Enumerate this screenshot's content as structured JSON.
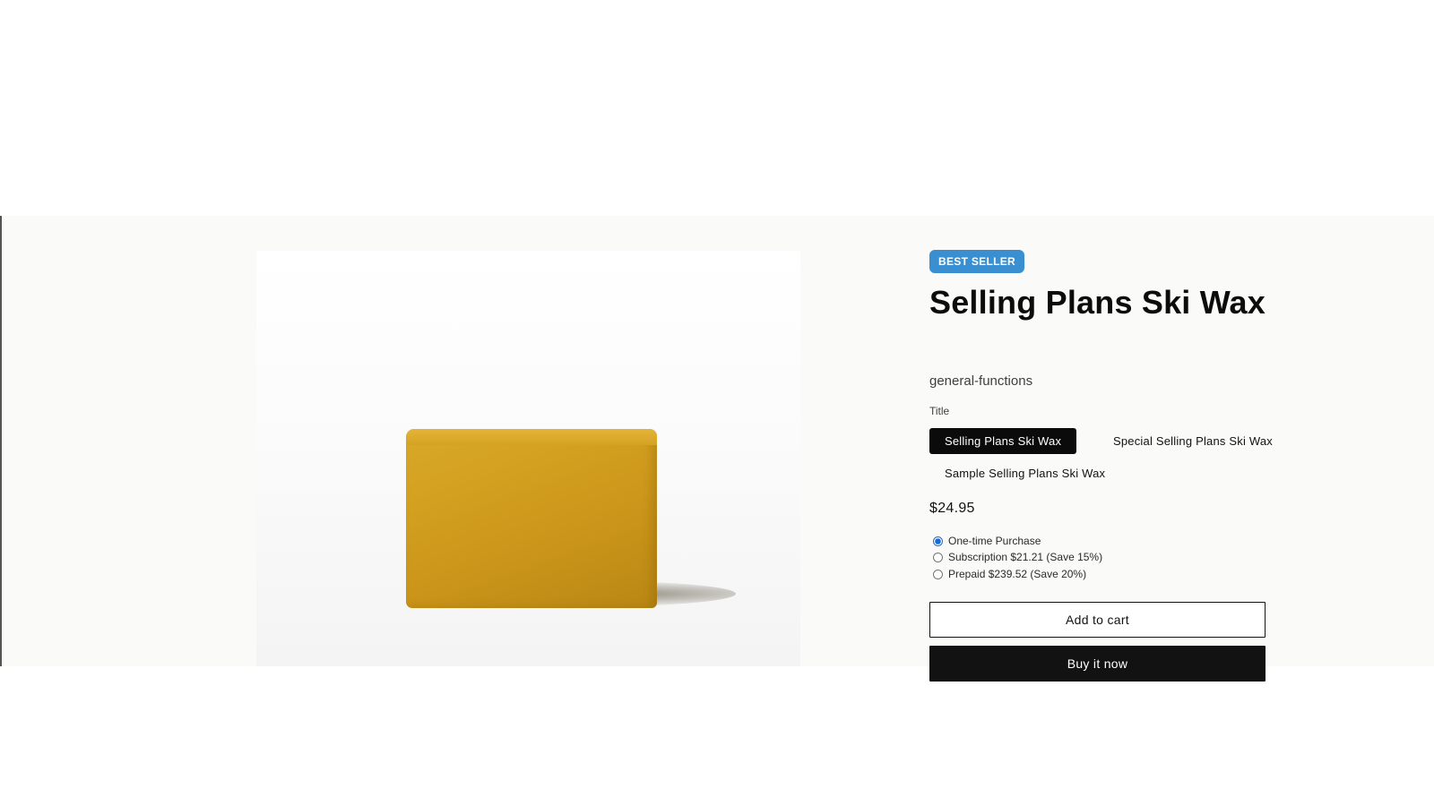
{
  "product": {
    "badge": "BEST SELLER",
    "title": "Selling Plans Ski Wax",
    "vendor": "general-functions",
    "option_label": "Title",
    "variants": [
      {
        "label": "Selling Plans Ski Wax",
        "selected": true
      },
      {
        "label": "Special Selling Plans Ski Wax",
        "selected": false
      },
      {
        "label": "Sample Selling Plans Ski Wax",
        "selected": false
      }
    ],
    "price": "$24.95",
    "selling_plans": [
      {
        "label": "One-time Purchase",
        "checked": true
      },
      {
        "label": "Subscription $21.21 (Save 15%)",
        "checked": false
      },
      {
        "label": "Prepaid $239.52 (Save 20%)",
        "checked": false
      }
    ],
    "add_to_cart_label": "Add to cart",
    "buy_now_label": "Buy it now"
  },
  "colors": {
    "badge": "#3a8fd0",
    "selected_variant": "#0b0b0b",
    "buy_now": "#121212",
    "section_bg": "#fafaf9",
    "wax": "#d4a020"
  }
}
